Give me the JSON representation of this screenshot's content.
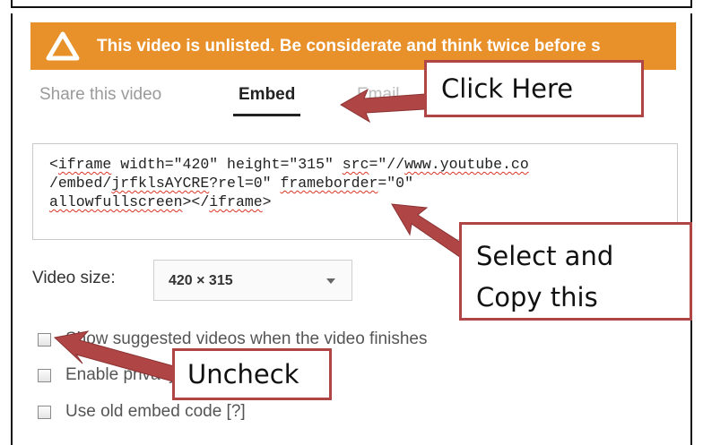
{
  "banner": {
    "icon": "warning-triangle-icon",
    "message": "This video is unlisted. Be considerate and think twice before s",
    "color": "#e8912a"
  },
  "tabs": {
    "share": "Share this video",
    "embed": "Embed",
    "email": "Email"
  },
  "embed_code": {
    "line1": [
      "<",
      "iframe",
      " width=\"420\" height=\"315\" ",
      "src",
      "=\"//",
      "www.youtube.co"
    ],
    "line2": [
      "/embed/",
      "jrfklsAYCRE",
      "?rel=0\" ",
      "frameborder",
      "=\"0\""
    ],
    "line3": [
      "allowfullscreen",
      "></",
      "iframe",
      ">"
    ]
  },
  "video_size": {
    "label": "Video size:",
    "value": "420 × 315"
  },
  "options": [
    {
      "label": "Show suggested videos when the video finishes",
      "checked": false
    },
    {
      "label": "Enable privacy-enhanced mode [?]",
      "checked": false
    },
    {
      "label": "Use old embed code [?]",
      "checked": false
    }
  ],
  "callouts": {
    "click_here": "Click Here",
    "select_copy_1": "Select and",
    "select_copy_2": "Copy this",
    "uncheck": "Uncheck"
  },
  "accent_colors": {
    "callout_border": "#b04545",
    "arrow": "#b04545"
  }
}
